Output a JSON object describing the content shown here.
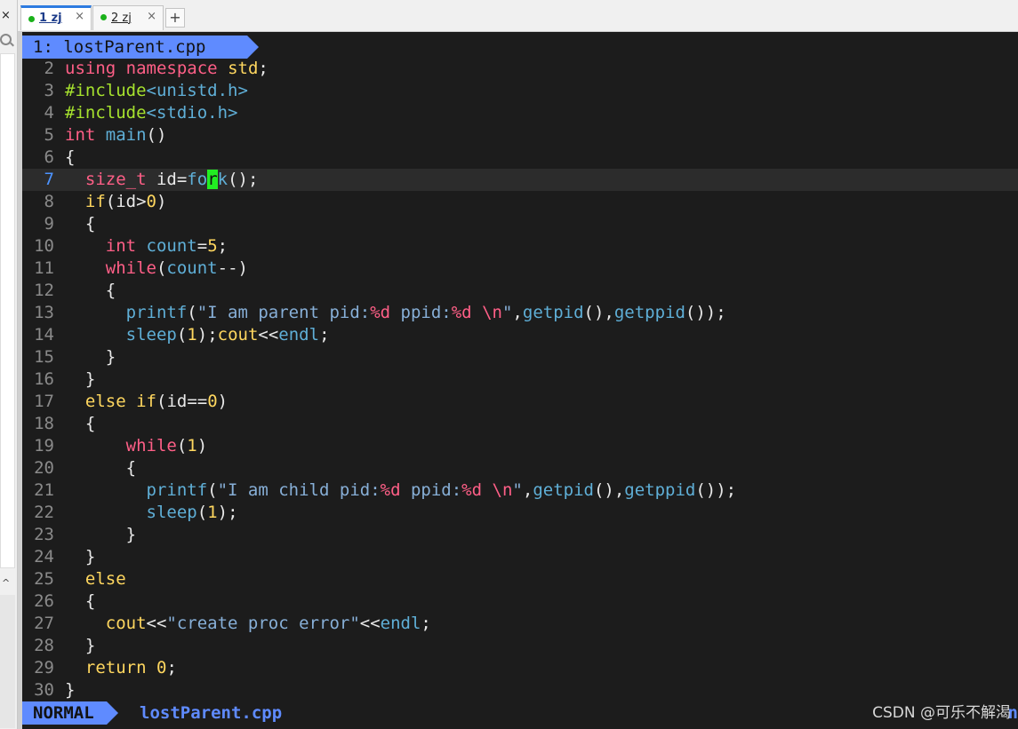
{
  "tabs": [
    {
      "label": "1 zj",
      "close": "×",
      "active": true
    },
    {
      "label": "2 zj",
      "close": "×",
      "active": false
    }
  ],
  "add_tab": "+",
  "side_close": "×",
  "side_scroll_up": "^",
  "vim_tabline": "1: lostParent.cpp",
  "cursor_line": 7,
  "colors": {
    "terminal_bg": "#1c1c1c",
    "accent": "#5f8bff",
    "cursor": "#22ee22"
  },
  "code_lines": [
    {
      "n": "2",
      "text": "using namespace std;"
    },
    {
      "n": "3",
      "text": "#include<unistd.h>"
    },
    {
      "n": "4",
      "text": "#include<stdio.h>"
    },
    {
      "n": "5",
      "text": "int main()"
    },
    {
      "n": "6",
      "text": "{"
    },
    {
      "n": "7",
      "text": "  size_t id=fork();"
    },
    {
      "n": "8",
      "text": "  if(id>0)"
    },
    {
      "n": "9",
      "text": "  {"
    },
    {
      "n": "10",
      "text": "    int count=5;"
    },
    {
      "n": "11",
      "text": "    while(count--)"
    },
    {
      "n": "12",
      "text": "    {"
    },
    {
      "n": "13",
      "text": "      printf(\"I am parent pid:%d ppid:%d \\n\",getpid(),getppid());"
    },
    {
      "n": "14",
      "text": "      sleep(1);cout<<endl;"
    },
    {
      "n": "15",
      "text": "    }"
    },
    {
      "n": "16",
      "text": "  }"
    },
    {
      "n": "17",
      "text": "  else if(id==0)"
    },
    {
      "n": "18",
      "text": "  {"
    },
    {
      "n": "19",
      "text": "      while(1)"
    },
    {
      "n": "20",
      "text": "      {"
    },
    {
      "n": "21",
      "text": "        printf(\"I am child pid:%d ppid:%d \\n\",getpid(),getppid());"
    },
    {
      "n": "22",
      "text": "        sleep(1);"
    },
    {
      "n": "23",
      "text": "      }"
    },
    {
      "n": "24",
      "text": "  }"
    },
    {
      "n": "25",
      "text": "  else"
    },
    {
      "n": "26",
      "text": "  {"
    },
    {
      "n": "27",
      "text": "    cout<<\"create proc error\"<<endl;"
    },
    {
      "n": "28",
      "text": "  }"
    },
    {
      "n": "29",
      "text": "  return 0;"
    },
    {
      "n": "30",
      "text": "}"
    }
  ],
  "status": {
    "mode": "NORMAL",
    "file": "lostParent.cpp",
    "right": "n"
  },
  "watermark": "CSDN @可乐不解渴"
}
